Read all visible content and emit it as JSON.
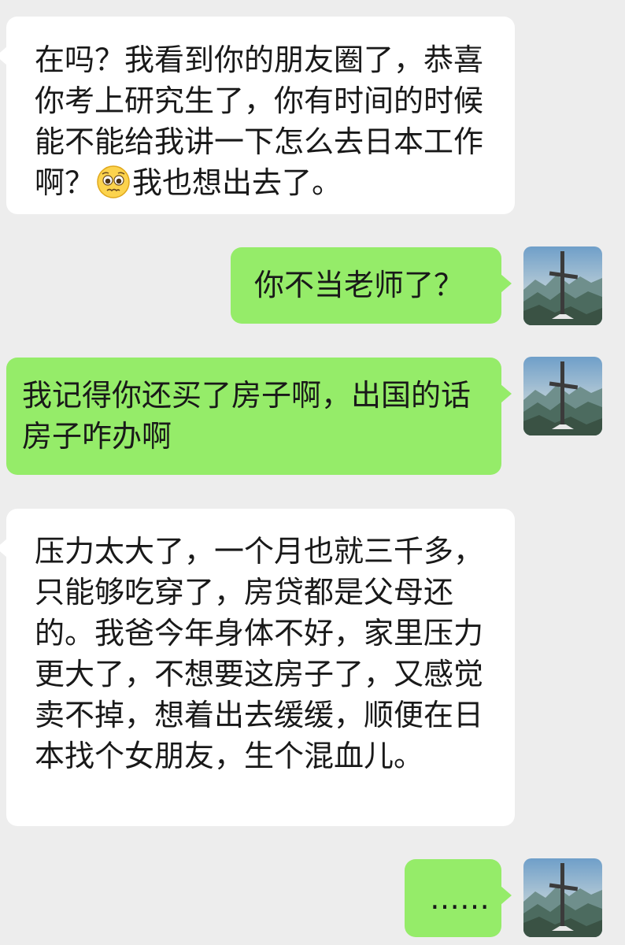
{
  "messages": [
    {
      "side": "left",
      "text_before_emoji": "在吗？我看到你的朋友圈了，恭喜你考上研究生了，你有时间的时候能不能给我讲一下怎么去日本工作啊？",
      "emoji": "pleading-face-emoji",
      "text_after_emoji": "我也想出去了。"
    },
    {
      "side": "right",
      "text": "你不当老师了？",
      "avatar": "cross-on-mountain-avatar"
    },
    {
      "side": "right",
      "text": "我记得你还买了房子啊，出国的话房子咋办啊",
      "avatar": "cross-on-mountain-avatar"
    },
    {
      "side": "left",
      "text": "压力太大了，一个月也就三千多，只能够吃穿了，房贷都是父母还的。我爸今年身体不好，家里压力更大了，不想要这房子了，又感觉卖不掉，想着出去缓缓，顺便在日本找个女朋友，生个混血儿。"
    },
    {
      "side": "right",
      "text": "……",
      "avatar": "cross-on-mountain-avatar"
    }
  ],
  "colors": {
    "background": "#ededed",
    "incoming_bubble": "#ffffff",
    "outgoing_bubble": "#95ec69",
    "text": "#191919"
  }
}
